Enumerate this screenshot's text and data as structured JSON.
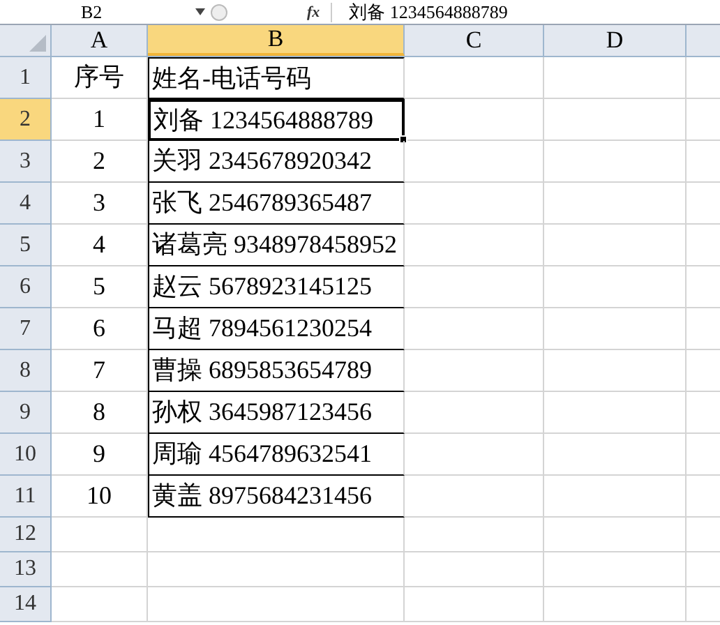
{
  "formula_bar": {
    "name_box": "B2",
    "function_label": "fx",
    "content": "刘备 1234564888789"
  },
  "columns": [
    {
      "label": "A",
      "selected": false
    },
    {
      "label": "B",
      "selected": true
    },
    {
      "label": "C",
      "selected": false
    },
    {
      "label": "D",
      "selected": false
    }
  ],
  "rows": [
    {
      "number": "1",
      "selected": false,
      "cells": [
        {
          "text": "序号",
          "selected": false
        },
        {
          "text": "姓名-电话号码",
          "selected": false
        }
      ]
    },
    {
      "number": "2",
      "selected": true,
      "cells": [
        {
          "text": "1",
          "selected": false
        },
        {
          "text": "刘备 1234564888789",
          "selected": true
        }
      ]
    },
    {
      "number": "3",
      "selected": false,
      "cells": [
        {
          "text": "2",
          "selected": false
        },
        {
          "text": "关羽 2345678920342",
          "selected": false
        }
      ]
    },
    {
      "number": "4",
      "selected": false,
      "cells": [
        {
          "text": "3",
          "selected": false
        },
        {
          "text": "张飞 2546789365487",
          "selected": false
        }
      ]
    },
    {
      "number": "5",
      "selected": false,
      "cells": [
        {
          "text": "4",
          "selected": false
        },
        {
          "text": "诸葛亮 9348978458952",
          "selected": false
        }
      ]
    },
    {
      "number": "6",
      "selected": false,
      "cells": [
        {
          "text": "5",
          "selected": false
        },
        {
          "text": "赵云 5678923145125",
          "selected": false
        }
      ]
    },
    {
      "number": "7",
      "selected": false,
      "cells": [
        {
          "text": "6",
          "selected": false
        },
        {
          "text": "马超 7894561230254",
          "selected": false
        }
      ]
    },
    {
      "number": "8",
      "selected": false,
      "cells": [
        {
          "text": "7",
          "selected": false
        },
        {
          "text": "曹操 6895853654789",
          "selected": false
        }
      ]
    },
    {
      "number": "9",
      "selected": false,
      "cells": [
        {
          "text": "8",
          "selected": false
        },
        {
          "text": "孙权 3645987123456",
          "selected": false
        }
      ]
    },
    {
      "number": "10",
      "selected": false,
      "cells": [
        {
          "text": "9",
          "selected": false
        },
        {
          "text": "周瑜 4564789632541",
          "selected": false
        }
      ]
    },
    {
      "number": "11",
      "selected": false,
      "cells": [
        {
          "text": "10",
          "selected": false
        },
        {
          "text": "黄盖 8975684231456",
          "selected": false
        }
      ]
    },
    {
      "number": "12",
      "selected": false
    },
    {
      "number": "13",
      "selected": false
    },
    {
      "number": "14",
      "selected": false
    }
  ]
}
